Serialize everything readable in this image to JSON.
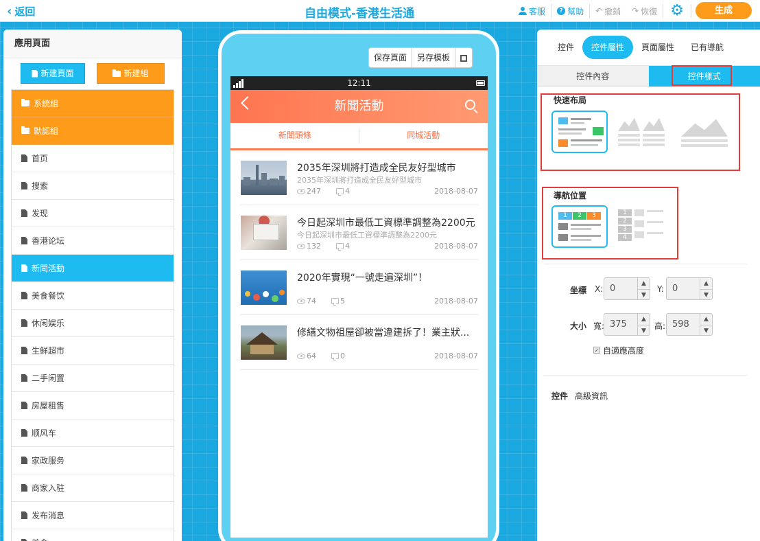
{
  "topbar": {
    "back_label": "返回",
    "title": "自由模式-香港生活通",
    "service_label": "客服",
    "help_label": "幫助",
    "undo_label": "撤銷",
    "redo_label": "恢復",
    "generate_label": "生成"
  },
  "left_panel": {
    "title": "應用頁面",
    "new_page_label": "新建頁面",
    "new_group_label": "新建組",
    "groups": [
      {
        "label": "系統組"
      },
      {
        "label": "默認組"
      }
    ],
    "pages": [
      {
        "label": "首页"
      },
      {
        "label": "搜索"
      },
      {
        "label": "发现"
      },
      {
        "label": "香港论坛"
      },
      {
        "label": "新聞活動"
      },
      {
        "label": "美食餐饮"
      },
      {
        "label": "休闲娱乐"
      },
      {
        "label": "生鲜超市"
      },
      {
        "label": "二手闲置"
      },
      {
        "label": "房屋租售"
      },
      {
        "label": "顺风车"
      },
      {
        "label": "家政服务"
      },
      {
        "label": "商家入驻"
      },
      {
        "label": "发布消息"
      },
      {
        "label": "美食"
      }
    ],
    "active_page": "新聞活動"
  },
  "phone": {
    "toolbar": {
      "save_page_label": "保存頁面",
      "save_template_label": "另存模板",
      "qr_icon": "qr-code-icon"
    },
    "status_time": "12:11",
    "nav_title": "新聞活動",
    "tabs": [
      "新聞頭條",
      "同城活動"
    ],
    "news": [
      {
        "title": "2035年深圳將打造成全民友好型城市",
        "subtitle": "2035年深圳將打造成全民友好型城市",
        "views": "247",
        "comments": "4",
        "date": "2018-08-07"
      },
      {
        "title": "今日起深圳市最低工資標準調整為2200元",
        "subtitle": "今日起深圳市最低工資標準調整為2200元",
        "views": "132",
        "comments": "4",
        "date": "2018-08-07"
      },
      {
        "title": "2020年實現“一號走遍深圳”！",
        "subtitle": "",
        "views": "74",
        "comments": "5",
        "date": "2018-08-07"
      },
      {
        "title": "修繕文物祖屋卻被當違建拆了！業主狀...",
        "subtitle": "",
        "views": "64",
        "comments": "0",
        "date": "2018-08-07"
      }
    ]
  },
  "right_panel": {
    "tabs": [
      "控件",
      "控件屬性",
      "頁面屬性",
      "已有導航"
    ],
    "active_tab": "控件屬性",
    "subtabs": [
      "控件內容",
      "控件樣式"
    ],
    "active_subtab": "控件樣式",
    "quick_layout_title": "快速布局",
    "nav_position_title": "導航位置",
    "coord_label": "坐標",
    "x_label": "X:",
    "y_label": "Y:",
    "x_value": "0",
    "y_value": "0",
    "size_label": "大小",
    "width_label": "寬:",
    "height_label": "高:",
    "width_value": "375",
    "height_value": "598",
    "auto_height_label": "自適應高度",
    "widget_label": "控件",
    "advanced_label": "高級資訊",
    "nav_numbers": [
      "1",
      "2",
      "3",
      "4"
    ],
    "colors": {
      "accent": "#1ebbf0",
      "orange": "#fe9b1b",
      "green": "#3cc468",
      "highlight": "#e53b3b"
    }
  }
}
